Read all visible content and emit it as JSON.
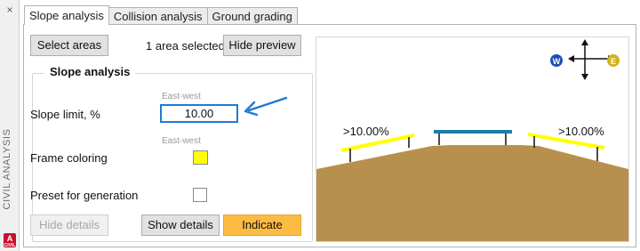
{
  "side_panel": {
    "close_glyph": "×",
    "title": "CIVIL ANALYSIS",
    "logo_letter": "A",
    "logo_sub": "CIVIL"
  },
  "tabs": [
    {
      "label": "Slope analysis",
      "active": true
    },
    {
      "label": "Collision analysis",
      "active": false
    },
    {
      "label": "Ground grading",
      "active": false
    }
  ],
  "toolbar": {
    "select_areas_label": "Select areas",
    "selection_status": "1 area selected",
    "hide_preview_label": "Hide preview"
  },
  "slope_group": {
    "title": "Slope analysis",
    "slope_limit_label": "Slope limit, %",
    "slope_limit_hint": "East-west",
    "slope_limit_value": "10.00",
    "frame_coloring_label": "Frame coloring",
    "frame_coloring_hint": "East-west",
    "frame_color": "#ffff00",
    "preset_label": "Preset for generation",
    "preset_checked": false
  },
  "actions": {
    "hide_details_label": "Hide details",
    "show_details_label": "Show details",
    "indicate_label": "Indicate"
  },
  "preview": {
    "compass_west": "W",
    "compass_east": "E",
    "left_slope_label": ">10.00%",
    "right_slope_label": ">10.00%",
    "ground_color": "#b8904e",
    "highlight_color": "#ffff00",
    "flat_segment_color": "#1a7da8",
    "west_color": "#1f4fb4",
    "east_color": "#d4b21a"
  },
  "accent_color": "#fcbb43"
}
